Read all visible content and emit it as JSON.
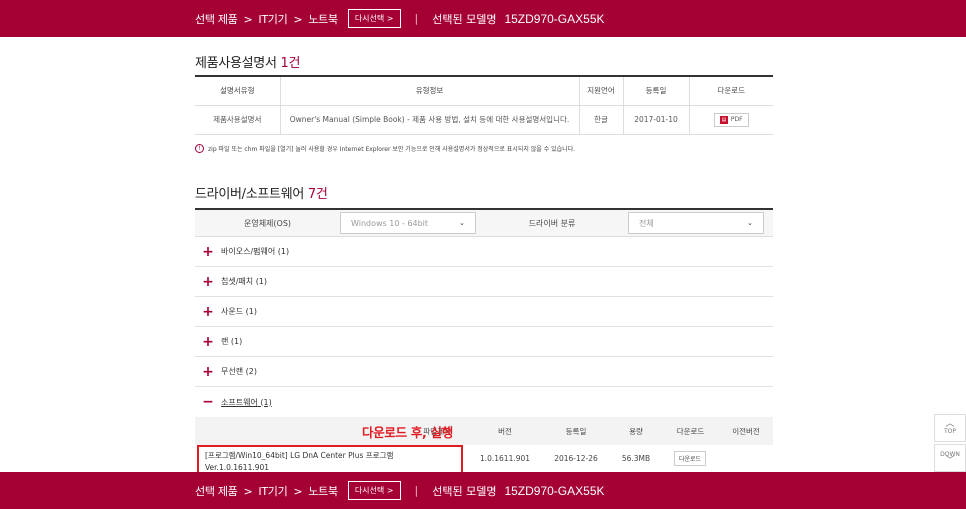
{
  "header": {
    "crumbs": [
      "선택 제품",
      "IT기기",
      "노트북"
    ],
    "reselect_label": "다시선택 >",
    "selected_model_label": "선택된 모델명",
    "model": "15ZD970-GAX55K"
  },
  "manuals": {
    "title": "제품사용설명서",
    "count": "1건",
    "columns": [
      "설명서유형",
      "유형정보",
      "지원언어",
      "등록일",
      "다운로드"
    ],
    "rows": [
      {
        "type": "제품사용설명서",
        "info": "Owner's Manual (Simple Book) - 제품 사용 방법, 설치 등에 대한 사용설명서입니다.",
        "language": "한글",
        "date": "2017-01-10",
        "download": "PDF"
      }
    ],
    "notice": "zip 파일 또는 chm 파일을 [열기] 눌러 사용할 경우 Internet Explorer 보안 기능으로 인해 사용설명서가 정상적으로 표시되지 않을 수 있습니다."
  },
  "drivers": {
    "title": "드라이버/소프트웨어",
    "count": "7건",
    "filter": {
      "os_label": "운영체제(OS)",
      "os_value": "Windows 10 - 64bit",
      "category_label": "드라이버 분류",
      "category_value": "전체"
    },
    "categories": [
      {
        "label": "바이오스/펌웨어",
        "count": "(1)",
        "state": "+"
      },
      {
        "label": "칩셋/패치",
        "count": "(1)",
        "state": "+"
      },
      {
        "label": "사운드",
        "count": "(1)",
        "state": "+"
      },
      {
        "label": "랜",
        "count": "(1)",
        "state": "+"
      },
      {
        "label": "무선랜",
        "count": "(2)",
        "state": "+"
      },
      {
        "label": "소프트웨어",
        "count": "(1)",
        "state": "−"
      }
    ],
    "software_columns": {
      "name": "파일제목",
      "version": "버전",
      "date": "등록일",
      "size": "용량",
      "download": "다운로드",
      "prev": "이전버전"
    },
    "annotation": "다운로드 후, 실행",
    "software_rows": [
      {
        "name_line1": "[프로그램/Win10_64bit] LG DnA Center Plus 프로그램",
        "name_line2": "Ver.1.0.1611.901",
        "version": "1.0.1611.901",
        "date": "2016-12-26",
        "size": "56.3MB",
        "download": "다운로드"
      }
    ]
  },
  "side": {
    "top": "TOP",
    "down": "DOWN"
  },
  "colors": {
    "brand": "#a50034",
    "annotation": "#e11b22"
  }
}
